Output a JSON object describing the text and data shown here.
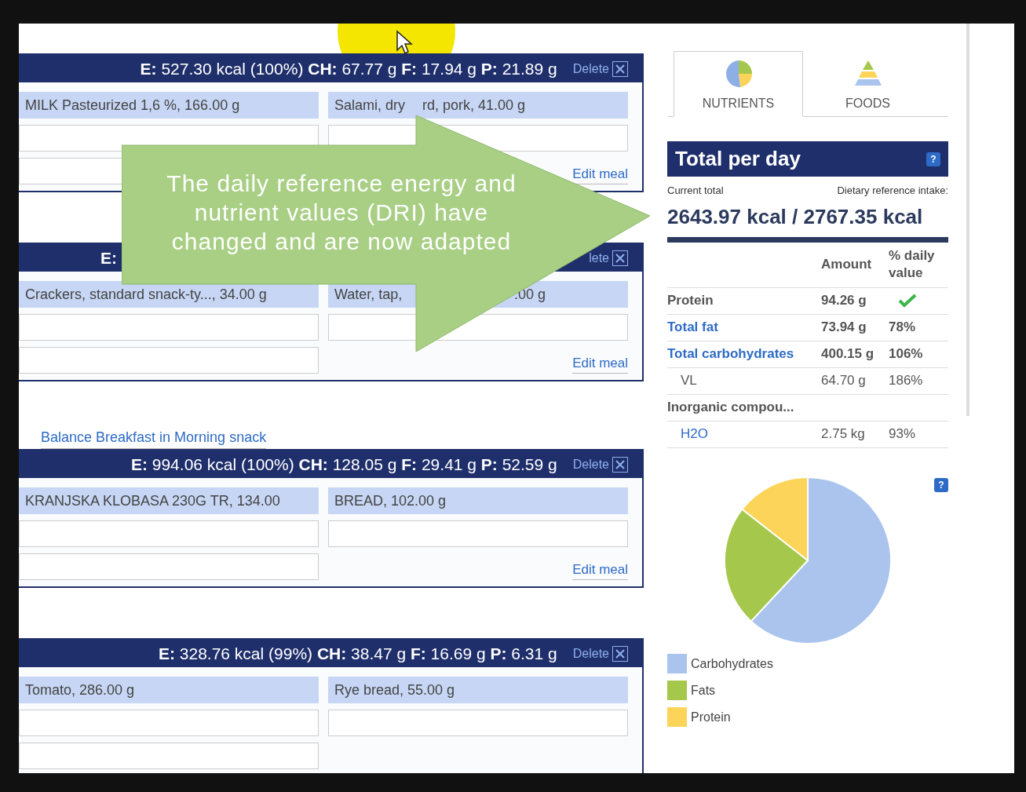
{
  "sections": [
    {
      "kind": "meal",
      "summary": "**E:** 527.30 kcal (100%) **CH:** 67.77 g **F:** 17.94 g **P:** 21.89 g",
      "delete": "Delete",
      "foods": [
        [
          "MILK Pasteurized 1,6 %, 166.00 g"
        ],
        [
          "Salami, dry",
          "rd, pork, 41.00 g"
        ]
      ],
      "edit": "Edit meal"
    },
    {
      "kind": "meal",
      "summary": "**E:**",
      "delete": "lete",
      "foods": [
        [
          "Crackers, standard snack-ty..., 34.00 g"
        ],
        [
          "Water, tap,",
          ".00 g"
        ]
      ],
      "edit": "Edit meal"
    },
    {
      "kind": "link",
      "text": "Balance Breakfast in Morning snack"
    },
    {
      "kind": "meal",
      "summary": "**E:** 994.06 kcal (100%) **CH:** 128.05 g **F:** 29.41 g **P:** 52.59 g",
      "delete": "Delete",
      "foods": [
        [
          "KRANJSKA KLOBASA 230G TR, 134.00"
        ],
        [
          "BREAD, 102.00 g"
        ]
      ],
      "edit": "Edit meal"
    },
    {
      "kind": "meal",
      "summary": "**E:** 328.76 kcal (99%) **CH:** 38.47 g **F:** 16.69 g **P:** 6.31 g",
      "delete": "Delete",
      "foods": [
        [
          "Tomato, 286.00 g"
        ],
        [
          "Rye bread, 55.00 g"
        ]
      ]
    }
  ],
  "callout": [
    "The daily reference energy and",
    "nutrient values (DRI) have",
    "changed and are now adapted"
  ],
  "tabs": [
    {
      "label": "NUTRIENTS",
      "selected": true
    },
    {
      "label": "FOODS",
      "selected": false
    }
  ],
  "total": {
    "title": "Total per day",
    "help": "?",
    "current_label": "Current total",
    "dri_label": "Dietary reference intake:",
    "value": "2643.97 kcal / 2767.35 kcal",
    "columns": [
      "Amount",
      "% daily value"
    ],
    "rows": [
      {
        "name": "Protein",
        "link": false,
        "amount": "94.26 g",
        "check": true
      },
      {
        "name": "Total fat",
        "link": true,
        "amount": "73.94 g",
        "dv": "78%",
        "check": false
      },
      {
        "name": "Total carbohydrates",
        "link": true,
        "amount": "400.15 g",
        "dv": "106%",
        "check": false,
        "children": [
          {
            "name": "VL",
            "link": false,
            "amount": "64.70 g",
            "dv": "186%",
            "check": false
          }
        ]
      },
      {
        "name": "Inorganic compou...",
        "link": false,
        "check": false,
        "children": [
          {
            "name": "H2O",
            "link": true,
            "amount": "2.75 kg",
            "dv": "93%",
            "check": false
          }
        ]
      }
    ]
  },
  "chart": {
    "help": "?",
    "legend": [
      {
        "label": "Carbohydrates",
        "color": "#aac4ee"
      },
      {
        "label": "Fats",
        "color": "#a5c84c"
      },
      {
        "label": "Protein",
        "color": "#fcd45a"
      }
    ]
  }
}
